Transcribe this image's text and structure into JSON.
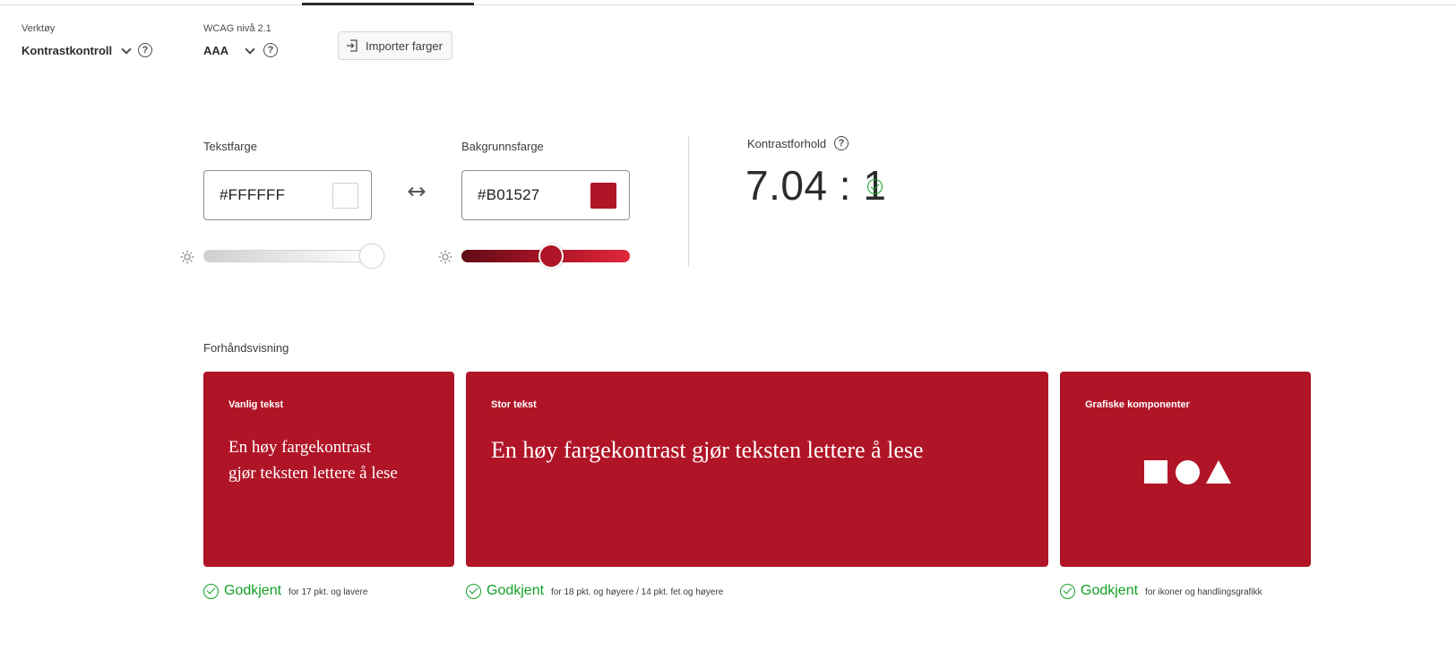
{
  "toolbar": {
    "tool_label": "Verktøy",
    "tool_value": "Kontrastkontroll",
    "wcag_label": "WCAG nivå 2.1",
    "wcag_value": "AAA",
    "import_label": "Importer farger",
    "help_glyph": "?"
  },
  "colors": {
    "text": {
      "label": "Tekstfarge",
      "hex": "#FFFFFF",
      "brightness": 1.0
    },
    "background": {
      "label": "Bakgrunnsfarge",
      "hex": "#B01527",
      "brightness": 0.53
    }
  },
  "contrast": {
    "label": "Kontrastforhold",
    "ratio": "7.04 : 1"
  },
  "preview": {
    "label": "Forhåndsvisning",
    "normal": {
      "title": "Vanlig tekst",
      "line1": "En høy fargekontrast",
      "line2": "gjør teksten lettere å lese",
      "verdict": "Godkjent",
      "note": "for 17 pkt. og lavere"
    },
    "large": {
      "title": "Stor tekst",
      "text": "En høy fargekontrast gjør teksten lettere å lese",
      "verdict": "Godkjent",
      "note": "for 18 pkt. og høyere / 14 pkt. fet og høyere"
    },
    "graphics": {
      "title": "Grafiske komponenter",
      "verdict": "Godkjent",
      "note": "for ikoner og handlingsgrafikk",
      "shapes": [
        "square",
        "circle",
        "triangle"
      ]
    }
  },
  "theme": {
    "accent": "#B01527",
    "pass": "#12A026"
  }
}
